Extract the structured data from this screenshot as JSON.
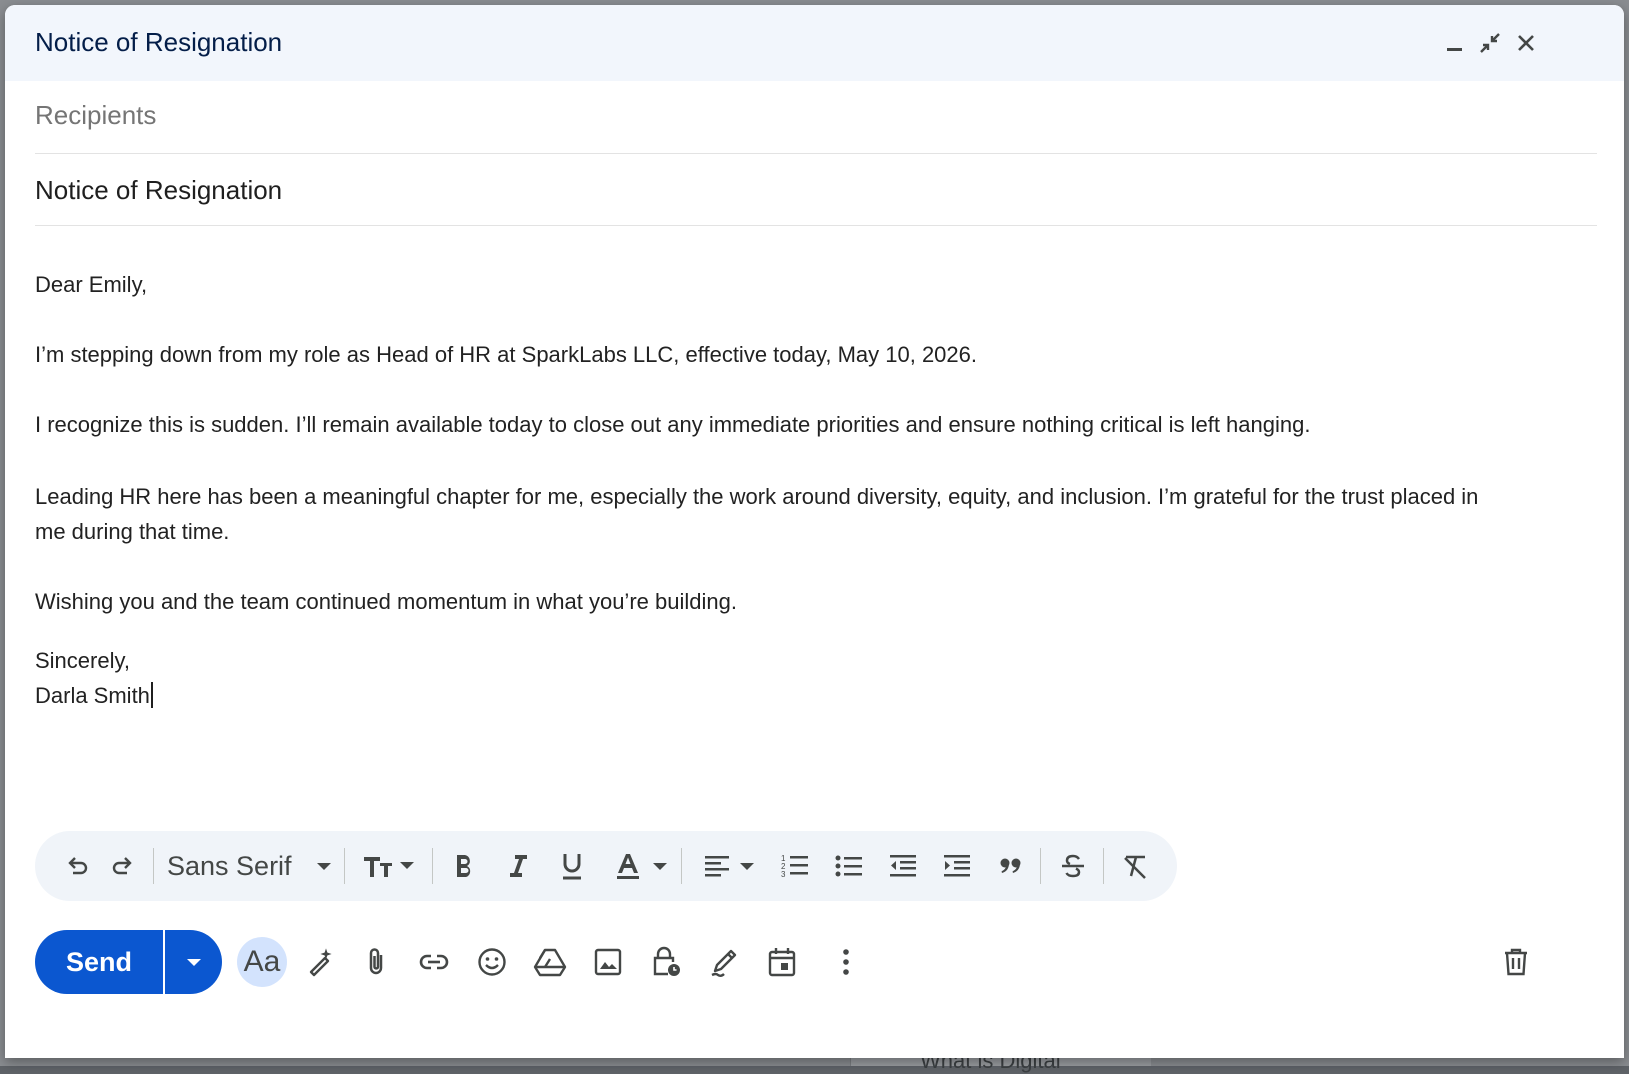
{
  "window": {
    "title": "Notice of Resignation"
  },
  "fields": {
    "recipients_placeholder": "Recipients",
    "subject": "Notice of Resignation"
  },
  "body": {
    "greeting": "Dear Emily,",
    "p1": "I’m stepping down from my role as Head of HR at SparkLabs LLC, effective today, May 10, 2026.",
    "p2": "I recognize this is sudden. I’ll remain available today to close out any immediate priorities and ensure nothing critical is left hanging.",
    "p3": "Leading HR here has been a meaningful chapter for me, especially the work around diversity, equity, and inclusion. I’m grateful for the trust placed in me during that time.",
    "p4": "Wishing you and the team continued momentum in what you’re building.",
    "closing": "Sincerely,",
    "signature": "Darla Smith"
  },
  "formatting_toolbar": {
    "font": "Sans Serif",
    "icons": [
      "undo-icon",
      "redo-icon",
      "font-dropdown-icon",
      "text-size-icon",
      "bold-icon",
      "italic-icon",
      "underline-icon",
      "text-color-icon",
      "align-icon",
      "numbered-list-icon",
      "bulleted-list-icon",
      "indent-less-icon",
      "indent-more-icon",
      "quote-icon",
      "strikethrough-icon",
      "remove-formatting-icon"
    ]
  },
  "bottom_toolbar": {
    "send_label": "Send",
    "format_toggle_label": "Aa",
    "icons": [
      "send-options-icon",
      "formatting-options-icon",
      "help-me-write-icon",
      "attach-icon",
      "link-icon",
      "emoji-icon",
      "drive-icon",
      "photo-icon",
      "confidential-mode-icon",
      "signature-icon",
      "schedule-icon",
      "more-options-icon",
      "discard-icon"
    ]
  },
  "background": {
    "peek_text": "What is Digital"
  },
  "colors": {
    "send_blue": "#0b57d0",
    "title_bar": "#f2f6fc",
    "toolbar_bg": "#f0f4f9",
    "aa_active": "#d3e3fd"
  }
}
